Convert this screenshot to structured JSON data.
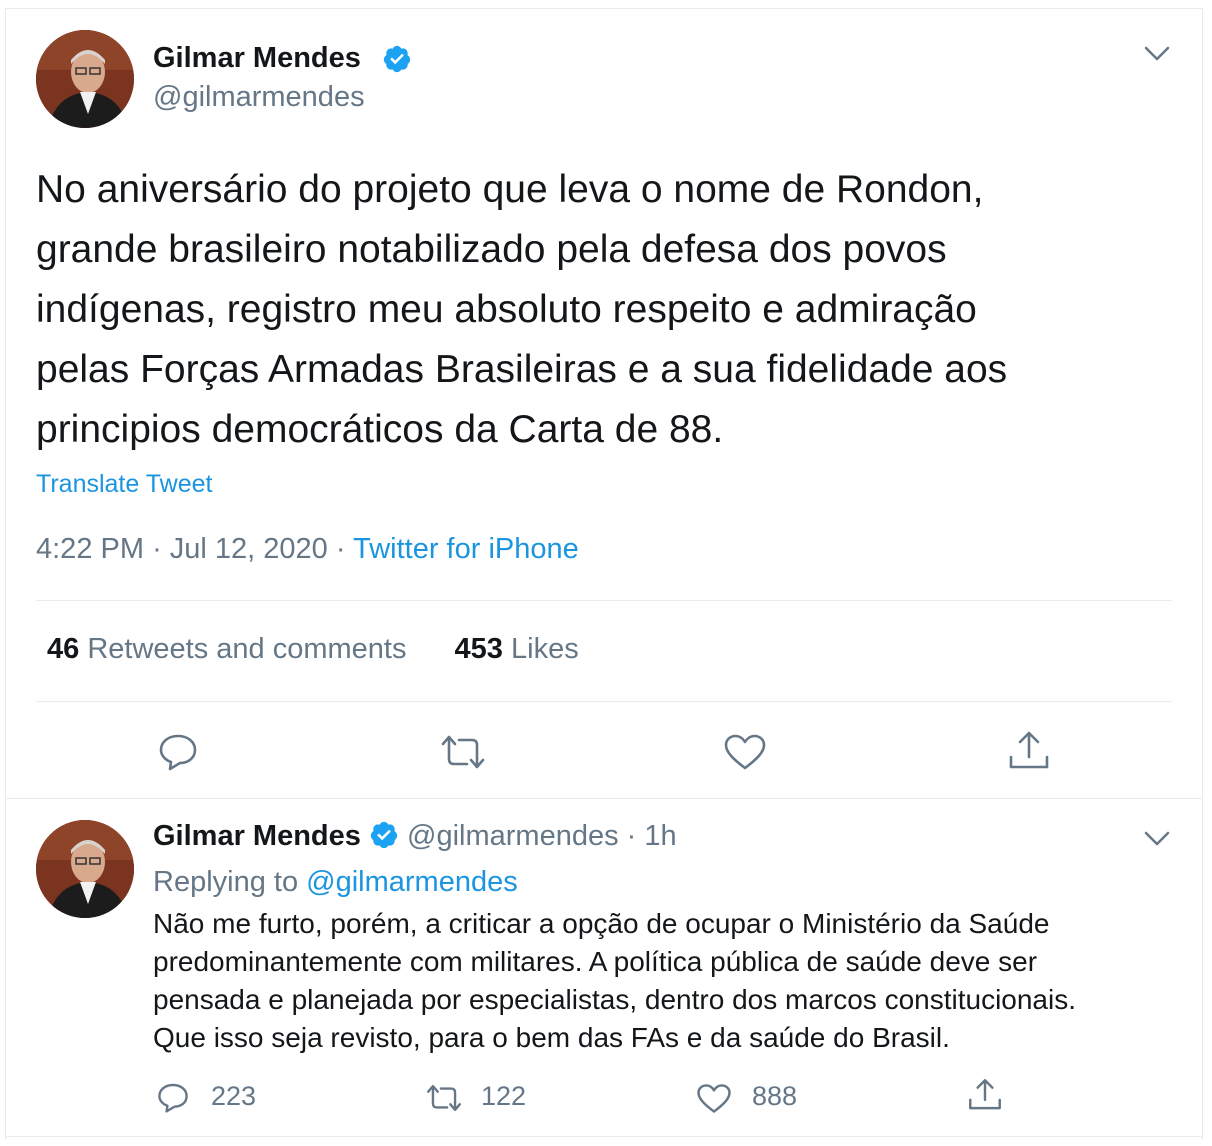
{
  "main_tweet": {
    "author_name": "Gilmar Mendes",
    "author_handle": "@gilmarmendes",
    "text_lines": [
      "No aniversário do projeto que leva o nome de Rondon,",
      "grande brasileiro notabilizado pela defesa dos povos",
      "indígenas, registro meu absoluto respeito e admiração",
      "pelas Forças Armadas Brasileiras e a sua fidelidade aos",
      "principios democráticos  da Carta de 88."
    ],
    "translate_label": "Translate Tweet",
    "time": "4:22 PM",
    "date": "Jul 12, 2020",
    "separator": "·",
    "source": "Twitter for iPhone",
    "retweets_count": "46",
    "retweets_label": "Retweets and comments",
    "likes_count": "453",
    "likes_label": "Likes"
  },
  "reply_tweet": {
    "author_name": "Gilmar Mendes",
    "author_handle": "@gilmarmendes",
    "time_ago": "1h",
    "separator": "·",
    "replying_prefix": "Replying to",
    "replying_to": "@gilmarmendes",
    "text_lines": [
      "Não me furto, porém, a criticar a opção de ocupar o Ministério da Saúde",
      "predominantemente com militares. A política pública de saúde deve ser",
      "pensada e planejada por especialistas, dentro dos marcos constitucionais.",
      "Que isso seja revisto, para o bem das FAs e da saúde do Brasil."
    ],
    "reply_count": "223",
    "retweet_count": "122",
    "like_count": "888"
  },
  "icons": {
    "verified": "verified-badge-icon",
    "chevron": "chevron-down-icon",
    "reply": "speech-bubble-icon",
    "retweet": "retweet-arrows-icon",
    "like": "heart-icon",
    "share": "share-upload-icon"
  },
  "colors": {
    "link": "#1b95e0",
    "secondary_text": "#657786",
    "primary_text": "#14171a",
    "border": "#e6ecf0",
    "verified": "#1da1f2"
  }
}
